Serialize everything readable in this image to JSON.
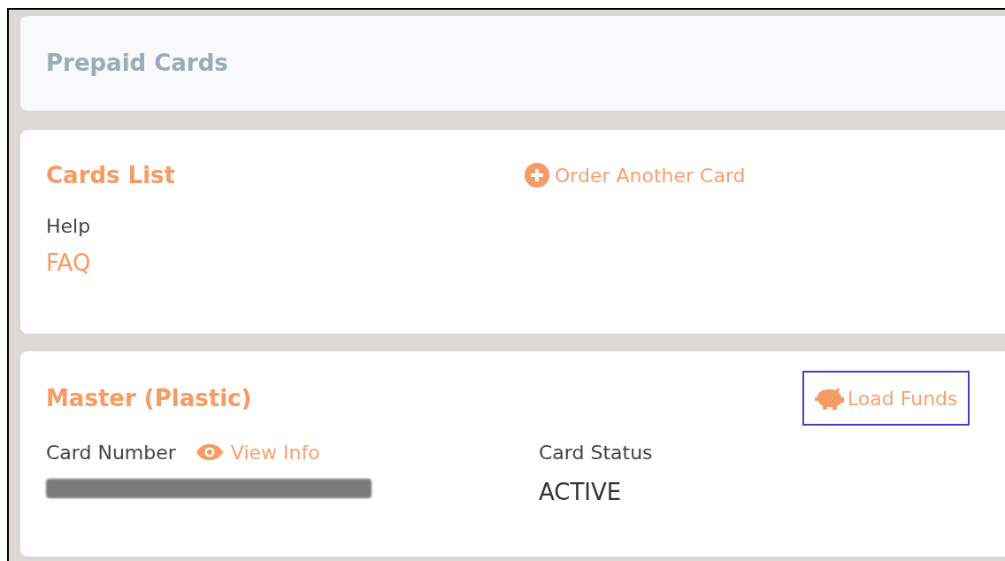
{
  "page_header": {
    "title": "Prepaid Cards"
  },
  "cards_list": {
    "title": "Cards List",
    "order_link": "Order Another Card",
    "help_label": "Help",
    "faq_link": "FAQ"
  },
  "card": {
    "title": "Master (Plastic)",
    "load_funds": {
      "label": "Load Funds",
      "highlighted": true
    },
    "card_number_label": "Card Number",
    "view_info_link": "View Info",
    "card_number_redacted": true,
    "status_label": "Card Status",
    "status_value": "ACTIVE"
  }
}
